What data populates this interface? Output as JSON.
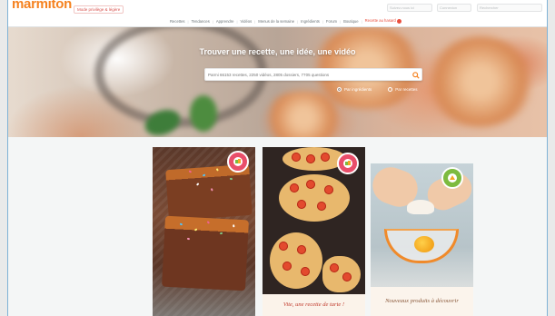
{
  "header": {
    "logo": "marmiton",
    "tagline": "Mode privilège & légère",
    "field_1": "Suivez-nous ici",
    "field_2": "Connexion",
    "field_3": "Rechercher",
    "nav": [
      {
        "label": "Recettes"
      },
      {
        "label": "Tendances"
      },
      {
        "label": "Apprendre"
      },
      {
        "label": "Vidéos"
      },
      {
        "label": "Menus de la semaine"
      },
      {
        "label": "Ingrédients"
      },
      {
        "label": "Forum"
      },
      {
        "label": "Boutique"
      },
      {
        "label": "Recette au hasard"
      }
    ]
  },
  "hero": {
    "title": "Trouver une recette, une idée, une vidéo",
    "search_placeholder": "Parmi 66153 recettes, 2250 vidéos, 2805 dossiers, 7705 questions",
    "option_1": "Par ingrédients",
    "option_2": "Par recettes"
  },
  "cards": {
    "card1_icon": "recipe-badge-icon",
    "card2_caption": "Vite, une recette de tarte !",
    "card2_icon": "recipe-badge-icon",
    "card3_caption": "Nouveaux produits à découvrir",
    "card3_icon": "product-badge-icon"
  },
  "colors": {
    "brand_orange": "#f58220",
    "hot_red": "#e94e3d",
    "badge_pink": "#e94e6a",
    "badge_green": "#7dbb3f"
  }
}
